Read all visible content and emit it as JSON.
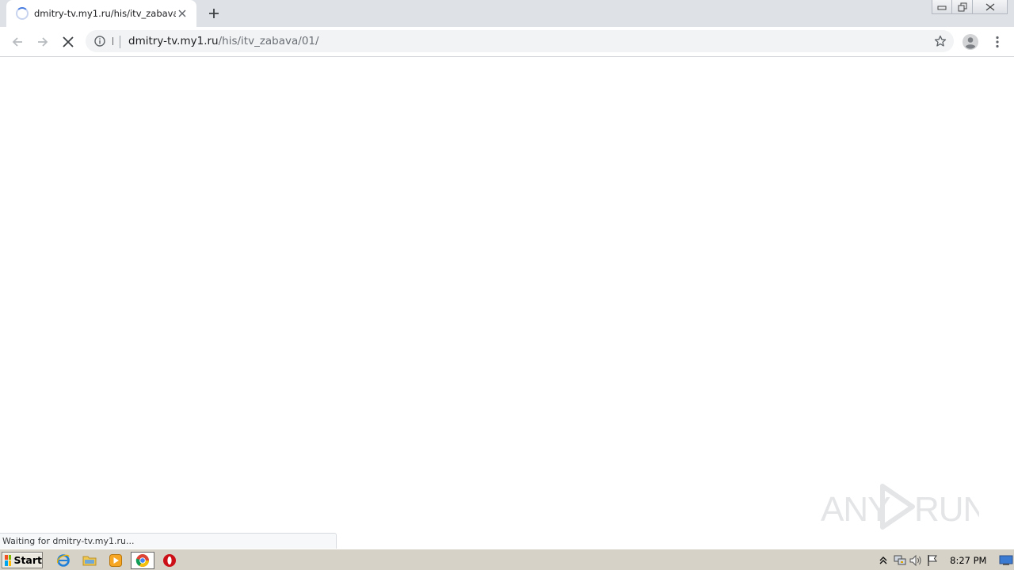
{
  "browser": {
    "tab": {
      "title": "dmitry-tv.my1.ru/his/itv_zabava/01/"
    },
    "address": {
      "host": "dmitry-tv.my1.ru",
      "path": "/his/itv_zabava/01/"
    },
    "status_text": "Waiting for dmitry-tv.my1.ru...",
    "icons": [
      "tab-loading-spinner",
      "close-icon",
      "plus-icon",
      "back-arrow-icon",
      "forward-arrow-icon",
      "stop-icon",
      "info-icon",
      "star-icon",
      "account-icon",
      "kebab-menu-icon",
      "minimize-icon",
      "restore-icon",
      "window-close-icon"
    ]
  },
  "watermark": {
    "text": "ANY RUN"
  },
  "taskbar": {
    "start_label": "Start",
    "clock": "8:27 PM",
    "quick_launch": [
      "internet-explorer-icon",
      "file-explorer-icon",
      "media-player-icon",
      "chrome-icon",
      "opera-icon"
    ],
    "tray": [
      "show-hidden-icons",
      "network-icon",
      "volume-icon",
      "action-center-flag-icon",
      "show-desktop-icon"
    ]
  },
  "colors": {
    "tabstrip": "#dee1e6",
    "omnibox": "#f1f3f4",
    "taskbar": "#d6d2c8",
    "spinner": "#4a7de0"
  }
}
